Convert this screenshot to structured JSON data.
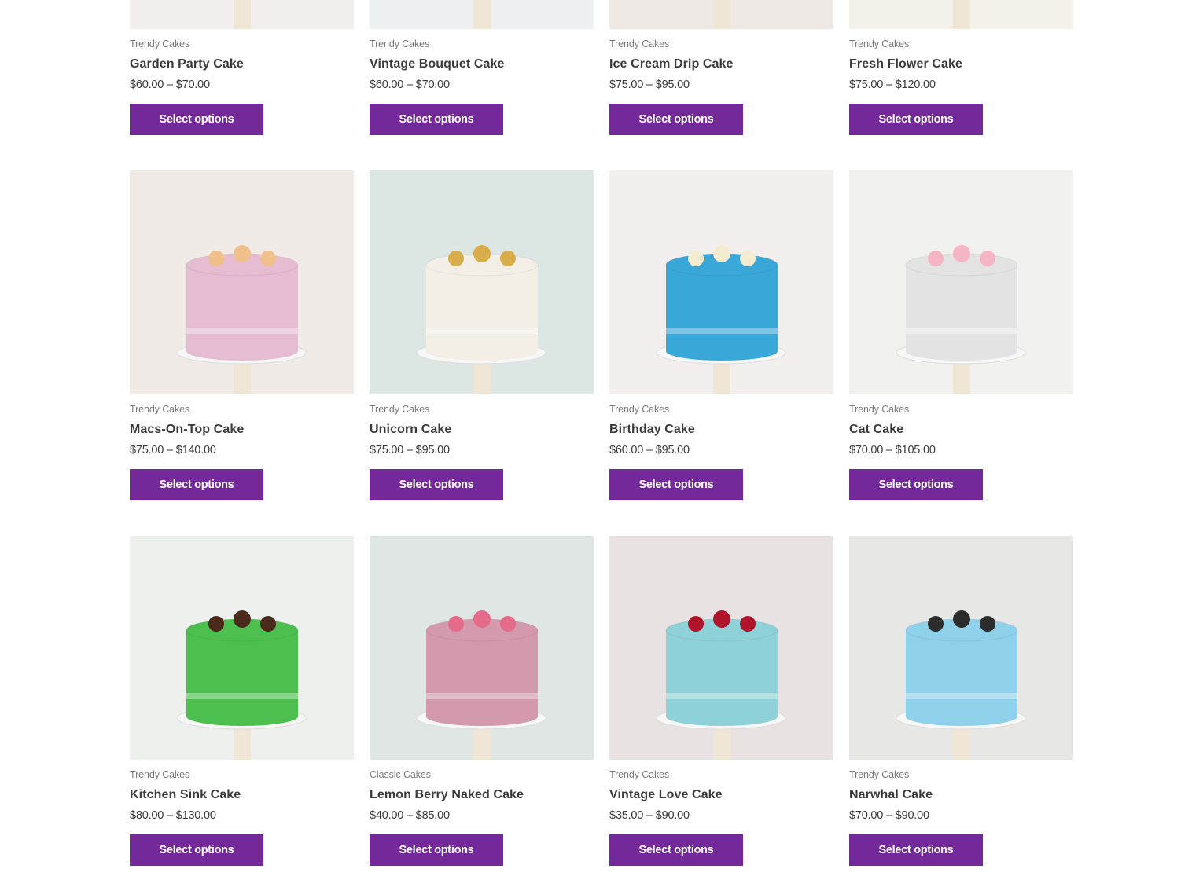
{
  "button_label": "Select options",
  "products": [
    {
      "category": "Trendy Cakes",
      "name": "Garden Party Cake",
      "price_min": "$60.00",
      "price_sep": "–",
      "price_max": "$70.00",
      "image": "cake-image",
      "palette": {
        "bg": "#f3efee",
        "cake": "#f4eef0",
        "accent": "#f2d58a"
      }
    },
    {
      "category": "Trendy Cakes",
      "name": "Vintage Bouquet Cake",
      "price_min": "$60.00",
      "price_sep": "–",
      "price_max": "$70.00",
      "image": "cake-image",
      "palette": {
        "bg": "#eef1f1",
        "cake": "#a9d6da",
        "accent": "#8fc6cc"
      }
    },
    {
      "category": "Trendy Cakes",
      "name": "Ice Cream Drip Cake",
      "price_min": "$75.00",
      "price_sep": "–",
      "price_max": "$95.00",
      "image": "cake-image",
      "palette": {
        "bg": "#efe9e6",
        "cake": "#6fd0d8",
        "accent": "#c98862"
      }
    },
    {
      "category": "Trendy Cakes",
      "name": "Fresh Flower Cake",
      "price_min": "$75.00",
      "price_sep": "–",
      "price_max": "$120.00",
      "image": "cake-image",
      "palette": {
        "bg": "#f4f0ea",
        "cake": "#f1ece4",
        "accent": "#e8e1d3"
      }
    },
    {
      "category": "Trendy Cakes",
      "name": "Macs-On-Top Cake",
      "price_min": "$75.00",
      "price_sep": "–",
      "price_max": "$140.00",
      "image": "cake-image",
      "palette": {
        "bg": "#f1ebe8",
        "cake": "#e6bcd3",
        "accent": "#f0c08a"
      }
    },
    {
      "category": "Trendy Cakes",
      "name": "Unicorn Cake",
      "price_min": "$75.00",
      "price_sep": "–",
      "price_max": "$95.00",
      "image": "cake-image",
      "palette": {
        "bg": "#dce6e2",
        "cake": "#f4efe6",
        "accent": "#d9ad4b"
      }
    },
    {
      "category": "Trendy Cakes",
      "name": "Birthday Cake",
      "price_min": "$60.00",
      "price_sep": "–",
      "price_max": "$95.00",
      "image": "cake-image",
      "palette": {
        "bg": "#f2efee",
        "cake": "#3aa7d9",
        "accent": "#f3ecd1"
      }
    },
    {
      "category": "Trendy Cakes",
      "name": "Cat Cake",
      "price_min": "$70.00",
      "price_sep": "–",
      "price_max": "$105.00",
      "image": "cake-image",
      "palette": {
        "bg": "#f1f1f0",
        "cake": "#e3e3e3",
        "accent": "#f5b5c4"
      }
    },
    {
      "category": "Trendy Cakes",
      "name": "Kitchen Sink Cake",
      "price_min": "$80.00",
      "price_sep": "–",
      "price_max": "$130.00",
      "image": "cake-image",
      "palette": {
        "bg": "#eef0ee",
        "cake": "#4cbf4f",
        "accent": "#4b2a1b"
      }
    },
    {
      "category": "Classic Cakes",
      "name": "Lemon Berry Naked Cake",
      "price_min": "$40.00",
      "price_sep": "–",
      "price_max": "$85.00",
      "image": "cake-image",
      "palette": {
        "bg": "#dfe6e4",
        "cake": "#d29aac",
        "accent": "#e46b8a"
      }
    },
    {
      "category": "Trendy Cakes",
      "name": "Vintage Love Cake",
      "price_min": "$35.00",
      "price_sep": "–",
      "price_max": "$90.00",
      "image": "cake-image",
      "palette": {
        "bg": "#e9e2e2",
        "cake": "#8ed1d8",
        "accent": "#b0142b"
      }
    },
    {
      "category": "Trendy Cakes",
      "name": "Narwhal Cake",
      "price_min": "$70.00",
      "price_sep": "–",
      "price_max": "$90.00",
      "image": "cake-image",
      "palette": {
        "bg": "#e7e7e6",
        "cake": "#8fd0ea",
        "accent": "#2c2c2c"
      }
    }
  ],
  "colors": {
    "button": "#74299a",
    "button_text": "#ffffff",
    "title": "#3b3b3b",
    "category": "#7a7a7a"
  }
}
